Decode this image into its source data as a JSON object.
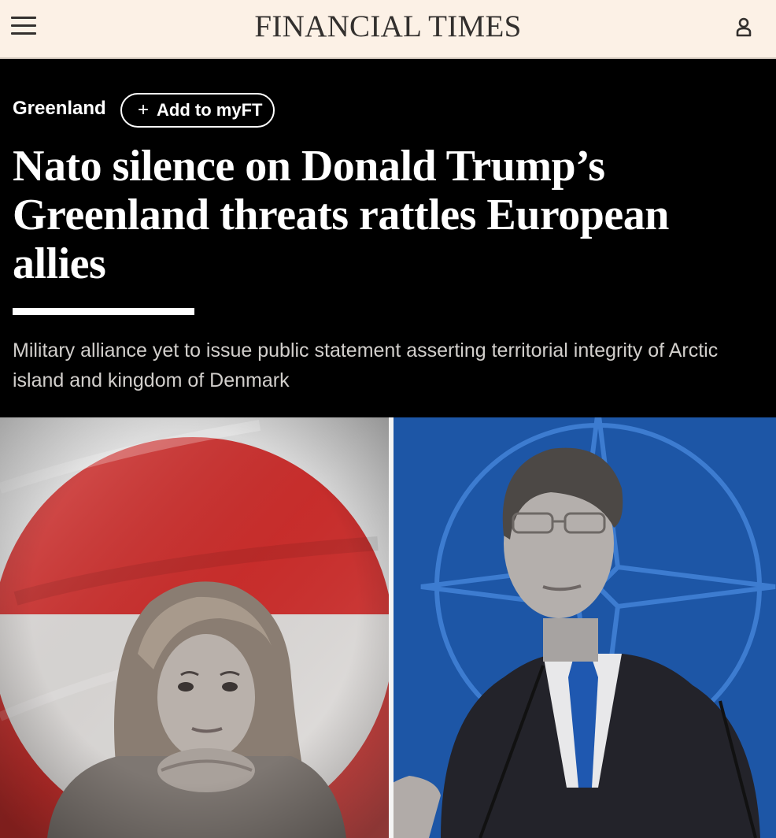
{
  "header": {
    "brand": "FINANCIAL TIMES",
    "menu_icon": "hamburger-menu-icon",
    "user_icon": "user-account-icon"
  },
  "article": {
    "topic": "Greenland",
    "follow_button": {
      "icon": "+",
      "label": "Add to myFT"
    },
    "headline": "Nato silence on Donald Trump’s Greenland threats rattles European allies",
    "standfirst": "Military alliance yet to issue public statement asserting territorial integrity of Arctic island and kingdom of Denmark"
  },
  "colors": {
    "masthead_bg": "#fcf1e6",
    "masthead_text": "#33302e",
    "page_bg": "#000000",
    "standfirst_text": "#d2cfcc",
    "greenland_flag_red": "#d8312f",
    "nato_blue": "#1d56a6"
  }
}
